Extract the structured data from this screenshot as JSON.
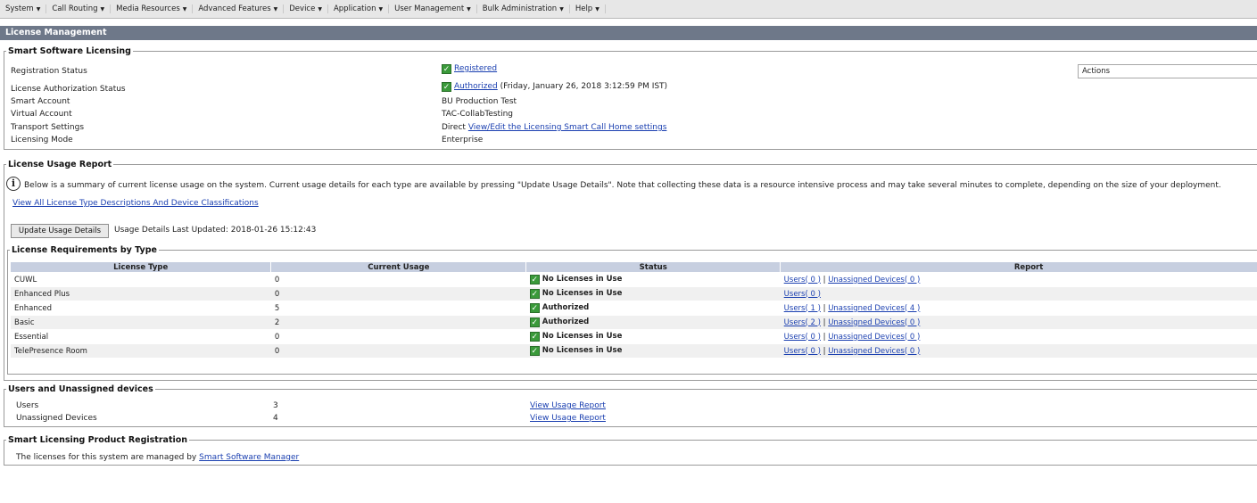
{
  "menubar": [
    "System",
    "Call Routing",
    "Media Resources",
    "Advanced Features",
    "Device",
    "Application",
    "User Management",
    "Bulk Administration",
    "Help"
  ],
  "page_title": "License Management",
  "smart_licensing": {
    "legend": "Smart Software Licensing",
    "registration_label": "Registration Status",
    "registration_value": "Registered",
    "auth_label": "License Authorization Status",
    "auth_value": "Authorized",
    "auth_time": "(Friday, January 26, 2018 3:12:59 PM IST)",
    "smart_account_label": "Smart Account",
    "smart_account_value": "BU Production Test",
    "virtual_account_label": "Virtual Account",
    "virtual_account_value": "TAC-CollabTesting",
    "transport_label": "Transport Settings",
    "transport_value": "Direct",
    "transport_link": "View/Edit the Licensing Smart Call Home settings",
    "mode_label": "Licensing Mode",
    "mode_value": "Enterprise",
    "actions_select": "Actions"
  },
  "usage_report": {
    "legend": "License Usage Report",
    "info_text": "Below is a summary of current license usage on the system. Current usage details for each type are available by pressing \"Update Usage Details\". Note that collecting these data is a resource intensive process and may take several minutes to complete, depending on the size of your deployment.",
    "descriptions_link": "View All License Type Descriptions And Device Classifications",
    "update_button": "Update Usage Details",
    "last_updated": "Usage Details Last Updated: 2018-01-26 15:12:43"
  },
  "requirements": {
    "legend": "License Requirements by Type",
    "headers": [
      "License Type",
      "Current Usage",
      "Status",
      "Report"
    ],
    "rows": [
      {
        "type": "CUWL",
        "usage": "0",
        "status": "No Licenses in Use",
        "users": "Users( 0 )",
        "unassigned": "Unassigned Devices( 0 )"
      },
      {
        "type": "Enhanced Plus",
        "usage": "0",
        "status": "No Licenses in Use",
        "users": "Users( 0 )",
        "unassigned": ""
      },
      {
        "type": "Enhanced",
        "usage": "5",
        "status": "Authorized",
        "users": "Users( 1 )",
        "unassigned": "Unassigned Devices( 4 )"
      },
      {
        "type": "Basic",
        "usage": "2",
        "status": "Authorized",
        "users": "Users( 2 )",
        "unassigned": "Unassigned Devices( 0 )"
      },
      {
        "type": "Essential",
        "usage": "0",
        "status": "No Licenses in Use",
        "users": "Users( 0 )",
        "unassigned": "Unassigned Devices( 0 )"
      },
      {
        "type": "TelePresence Room",
        "usage": "0",
        "status": "No Licenses in Use",
        "users": "Users( 0 )",
        "unassigned": "Unassigned Devices( 0 )"
      }
    ],
    "separator": "|"
  },
  "users_devices": {
    "legend": "Users and Unassigned devices",
    "users_label": "Users",
    "users_count": "3",
    "users_link": "View Usage Report",
    "unassigned_label": "Unassigned Devices",
    "unassigned_count": "4",
    "unassigned_link": "View Usage Report"
  },
  "product_registration": {
    "legend": "Smart Licensing Product Registration",
    "text": "The licenses for this system are managed by",
    "link": "Smart Software Manager"
  },
  "colors": {
    "menubar": "#e7e7e7",
    "page_header": "#6e7889",
    "table_header": "#c7cfe0",
    "check_green": "#3a9a3a",
    "link": "#1a3fb0"
  }
}
